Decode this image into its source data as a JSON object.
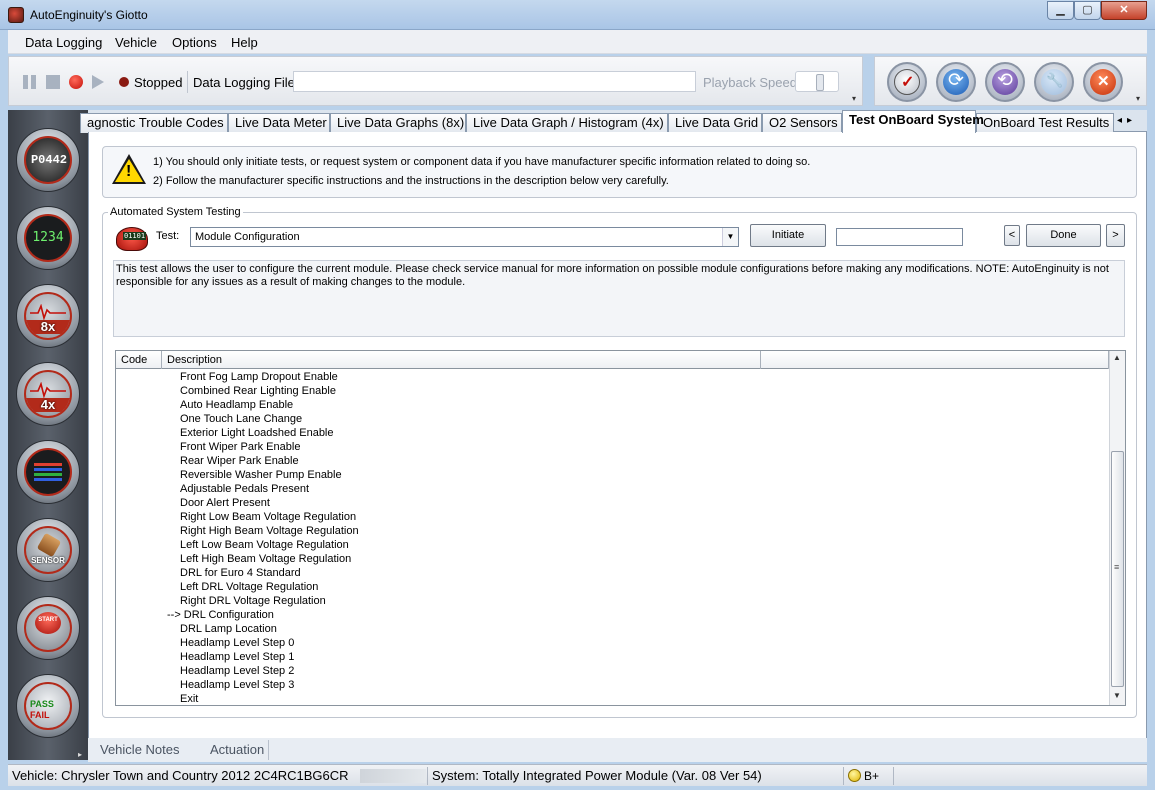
{
  "window": {
    "title": "AutoEnginuity's Giotto",
    "minimize": "▁",
    "maximize": "▢",
    "close": "✕"
  },
  "menu": {
    "items": [
      {
        "label": "Data Logging"
      },
      {
        "label": "Vehicle"
      },
      {
        "label": "Options"
      },
      {
        "label": "Help"
      }
    ]
  },
  "toolbar": {
    "status": "Stopped",
    "logging_file_label": "Data Logging File",
    "logging_file_value": "",
    "playback_label": "Playback Speed",
    "overflow": "▾"
  },
  "rail": {
    "dtc_code": "P0442",
    "meter_digits": "1234",
    "graph8_label": "8x",
    "graph4_label": "4x",
    "o2_label": "SENSOR",
    "start_label": "START",
    "pass_label": "PASS",
    "fail_label": "FAIL",
    "expand": "▸"
  },
  "tabs": [
    {
      "label": "agnostic Trouble Codes"
    },
    {
      "label": "Live Data Meter"
    },
    {
      "label": "Live Data Graphs (8x)"
    },
    {
      "label": "Live Data Graph / Histogram (4x)"
    },
    {
      "label": "Live Data Grid"
    },
    {
      "label": "O2 Sensors"
    },
    {
      "label": "Test OnBoard System"
    },
    {
      "label": "OnBoard Test Results"
    }
  ],
  "tab_scroll": {
    "left": "◂",
    "right": "▸"
  },
  "warning": {
    "line1": "1) You should only initiate tests, or request system or component data if you have manufacturer specific information related to doing so.",
    "line2": "2) Follow the manufacturer specific instructions and the instructions in the description below very carefully."
  },
  "automated_testing": {
    "group_label": "Automated System Testing",
    "test_icon_text": "01101",
    "test_label": "Test:",
    "selected_test": "Module Configuration",
    "initiate_label": "Initiate",
    "result_value": "",
    "prev_label": "<",
    "done_label": "Done",
    "next_label": ">",
    "description": "This test allows the user to configure the current module. Please check service manual for more information on possible module configurations before making any modifications. NOTE: AutoEnginuity is not responsible for any issues as a result of making changes to the module."
  },
  "list": {
    "col_code": "Code",
    "col_description": "Description",
    "rows": [
      {
        "text": "Front Fog Lamp Dropout Enable",
        "marked": false
      },
      {
        "text": "Combined Rear Lighting Enable",
        "marked": false
      },
      {
        "text": "Auto Headlamp Enable",
        "marked": false
      },
      {
        "text": "One Touch Lane Change",
        "marked": false
      },
      {
        "text": "Exterior Light Loadshed Enable",
        "marked": false
      },
      {
        "text": "Front Wiper Park Enable",
        "marked": false
      },
      {
        "text": "Rear Wiper Park Enable",
        "marked": false
      },
      {
        "text": "Reversible Washer Pump Enable",
        "marked": false
      },
      {
        "text": "Adjustable Pedals Present",
        "marked": false
      },
      {
        "text": "Door Alert Present",
        "marked": false
      },
      {
        "text": "Right Low Beam Voltage Regulation",
        "marked": false
      },
      {
        "text": "Right High Beam Voltage Regulation",
        "marked": false
      },
      {
        "text": "Left Low Beam Voltage Regulation",
        "marked": false
      },
      {
        "text": "Left High Beam Voltage Regulation",
        "marked": false
      },
      {
        "text": "DRL for Euro 4 Standard",
        "marked": false
      },
      {
        "text": "Left DRL Voltage Regulation",
        "marked": false
      },
      {
        "text": "Right DRL Voltage Regulation",
        "marked": false
      },
      {
        "text": "--> DRL Configuration",
        "marked": true
      },
      {
        "text": "DRL Lamp Location",
        "marked": false
      },
      {
        "text": "Headlamp Level Step 0",
        "marked": false
      },
      {
        "text": "Headlamp Level Step 1",
        "marked": false
      },
      {
        "text": "Headlamp Level Step 2",
        "marked": false
      },
      {
        "text": "Headlamp Level Step 3",
        "marked": false
      },
      {
        "text": "Exit",
        "marked": false
      }
    ],
    "scroll_up": "▲",
    "scroll_down": "▼",
    "scroll_grip": "≡"
  },
  "bottom_tabs": [
    {
      "label": "Vehicle Notes"
    },
    {
      "label": "Actuation"
    }
  ],
  "statusbar": {
    "vehicle": "Vehicle: Chrysler  Town and Country  2012  2C4RC1BG6CR",
    "system": "System: Totally Integrated Power Module (Var. 08 Ver 54)",
    "connection": "B+"
  },
  "colors": {
    "accent_red": "#c4100a",
    "meter_green": "#6ef06e",
    "warning_yellow": "#ffd800"
  }
}
